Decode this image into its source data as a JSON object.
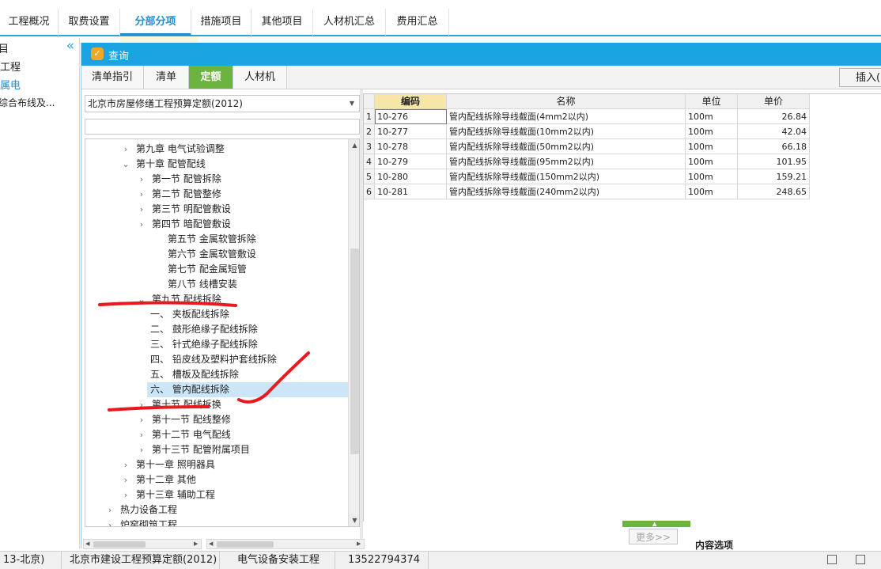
{
  "top_tabs": [
    {
      "label": "工程概况"
    },
    {
      "label": "取费设置"
    },
    {
      "label": "分部分项"
    },
    {
      "label": "措施项目"
    },
    {
      "label": "其他项目"
    },
    {
      "label": "人材机汇总"
    },
    {
      "label": "费用汇总"
    }
  ],
  "left_nav": {
    "items": [
      {
        "label": "目"
      },
      {
        "label": "工程"
      },
      {
        "label": "属电"
      },
      {
        "label": "综合布线及..."
      }
    ]
  },
  "dialog": {
    "title": "查询",
    "tabs": [
      {
        "label": "清单指引"
      },
      {
        "label": "清单"
      },
      {
        "label": "定额"
      },
      {
        "label": "人材机"
      }
    ],
    "insert_label": "插入(I)",
    "library_select": "北京市房屋修缮工程预算定额(2012)",
    "more_label": "更多>>",
    "content_options_label": "内容选项"
  },
  "tree": [
    {
      "label": "第九章 电气试验调整",
      "expanded": false
    },
    {
      "label": "第十章 配管配线",
      "expanded": true
    },
    {
      "label": "第一节 配管拆除",
      "expanded": false
    },
    {
      "label": "第二节 配管整修",
      "expanded": false
    },
    {
      "label": "第三节 明配管敷设",
      "expanded": false
    },
    {
      "label": "第四节 暗配管敷设",
      "expanded": false
    },
    {
      "label": "第五节 金属软管拆除"
    },
    {
      "label": "第六节 金属软管敷设"
    },
    {
      "label": "第七节 配金属短管"
    },
    {
      "label": "第八节 线槽安装"
    },
    {
      "label": "第九节 配线拆除",
      "expanded": true
    },
    {
      "label": "一、 夹板配线拆除"
    },
    {
      "label": "二、 鼓形绝缘子配线拆除"
    },
    {
      "label": "三、 针式绝缘子配线拆除"
    },
    {
      "label": "四、 铅皮线及塑料护套线拆除"
    },
    {
      "label": "五、 槽板及配线拆除"
    },
    {
      "label": "六、 管内配线拆除",
      "selected": true
    },
    {
      "label": "第十节 配线拆换",
      "expanded": false
    },
    {
      "label": "第十一节 配线整修",
      "expanded": false
    },
    {
      "label": "第十二节 电气配线",
      "expanded": false
    },
    {
      "label": "第十三节 配管附属项目",
      "expanded": false
    },
    {
      "label": "第十一章 照明器具",
      "expanded": false
    },
    {
      "label": "第十二章 其他",
      "expanded": false
    },
    {
      "label": "第十三章 辅助工程",
      "expanded": false
    },
    {
      "label": "热力设备工程",
      "expanded": false
    },
    {
      "label": "炉窑砌筑工程",
      "expanded": false
    }
  ],
  "grid": {
    "headers": {
      "code": "编码",
      "name": "名称",
      "unit": "单位",
      "price": "单价"
    },
    "rows": [
      {
        "n": "1",
        "code": "10-276",
        "name": "管内配线拆除导线截面(4mm2以内)",
        "unit": "100m",
        "price": "26.84"
      },
      {
        "n": "2",
        "code": "10-277",
        "name": "管内配线拆除导线截面(10mm2以内)",
        "unit": "100m",
        "price": "42.04"
      },
      {
        "n": "3",
        "code": "10-278",
        "name": "管内配线拆除导线截面(50mm2以内)",
        "unit": "100m",
        "price": "66.18"
      },
      {
        "n": "4",
        "code": "10-279",
        "name": "管内配线拆除导线截面(95mm2以内)",
        "unit": "100m",
        "price": "101.95"
      },
      {
        "n": "5",
        "code": "10-280",
        "name": "管内配线拆除导线截面(150mm2以内)",
        "unit": "100m",
        "price": "159.21"
      },
      {
        "n": "6",
        "code": "10-281",
        "name": "管内配线拆除导线截面(240mm2以内)",
        "unit": "100m",
        "price": "248.65"
      }
    ]
  },
  "status_bar": {
    "region": "13-北京)",
    "quota": "北京市建设工程预算定额(2012)",
    "project": "电气设备安装工程",
    "phone": "13522794374"
  },
  "colors": {
    "title_bar": "#1aa4e2",
    "active_tab": "#6db33f",
    "accent_blue": "#1f8fd0",
    "annotation": "#e8191f"
  }
}
